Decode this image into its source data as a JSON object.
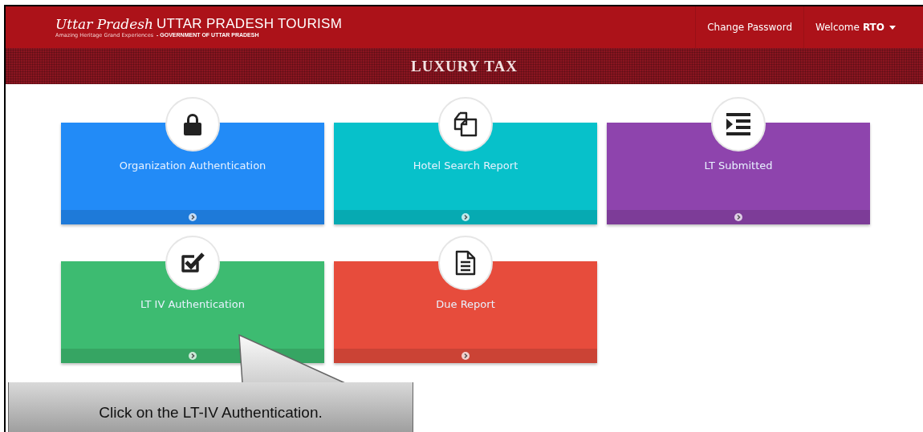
{
  "header": {
    "logo_script": "Uttar Pradesh",
    "logo_tagline": "Amazing Heritage Grand Experiences",
    "title": "UTTAR PRADESH TOURISM",
    "subtitle": "- GOVERNMENT OF UTTAR PRADESH",
    "nav": [
      {
        "label": "Change Password"
      }
    ],
    "welcome": "Welcome",
    "user": "RTO"
  },
  "banner": {
    "title": "LUXURY TAX"
  },
  "tiles": [
    {
      "label": "Organization Authentication",
      "kind": "lock",
      "color": "#228bf7"
    },
    {
      "label": "Hotel Search Report",
      "kind": "copy",
      "color": "#07c1ca"
    },
    {
      "label": "LT Submitted",
      "kind": "indent",
      "color": "#8e44ad"
    },
    {
      "label": "LT IV Authentication",
      "kind": "check",
      "color": "#3dbb71"
    },
    {
      "label": "Due Report",
      "kind": "file",
      "color": "#e74c3c"
    }
  ],
  "callout": {
    "text": "Click on the LT-IV Authentication."
  }
}
